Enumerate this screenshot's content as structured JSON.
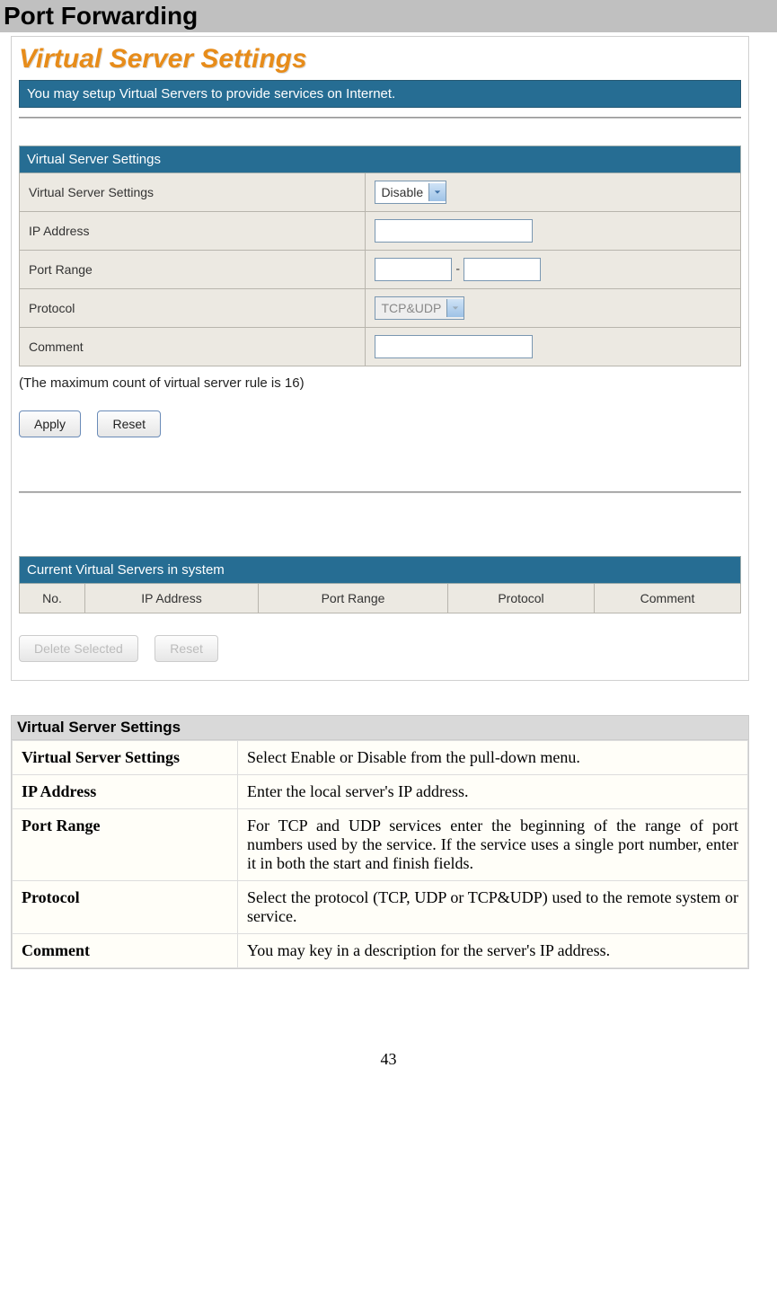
{
  "page_title": "Port Forwarding",
  "settings_heading": "Virtual Server Settings",
  "info_bar": "You may setup Virtual Servers to provide services on Internet.",
  "form": {
    "section_header": "Virtual Server Settings",
    "rows": {
      "vss_label": "Virtual Server Settings",
      "vss_value": "Disable",
      "ip_label": "IP Address",
      "ip_value": "",
      "pr_label": "Port Range",
      "pr_start": "",
      "pr_end": "",
      "pr_sep": "-",
      "proto_label": "Protocol",
      "proto_value": "TCP&UDP",
      "comment_label": "Comment",
      "comment_value": ""
    },
    "note": "(The maximum count of virtual server rule is 16)",
    "apply": "Apply",
    "reset": "Reset"
  },
  "current": {
    "header": "Current Virtual Servers in system",
    "cols": {
      "no": "No.",
      "ip": "IP Address",
      "pr": "Port Range",
      "proto": "Protocol",
      "comment": "Comment"
    },
    "delete": "Delete Selected",
    "reset": "Reset"
  },
  "help": {
    "title": "Virtual Server Settings",
    "rows": [
      {
        "label": "Virtual Server Settings",
        "desc": "Select Enable or Disable from the pull-down menu."
      },
      {
        "label": "IP Address",
        "desc": "Enter the local server's IP address."
      },
      {
        "label": "Port Range",
        "desc": "For TCP and UDP services enter the beginning of the range of port numbers used by the service. If the service uses a single port number, enter it in both the start and finish fields."
      },
      {
        "label": "Protocol",
        "desc": "Select the protocol (TCP, UDP or TCP&UDP) used to the remote system or service."
      },
      {
        "label": "Comment",
        "desc": "You may key in a description for the server's IP address."
      }
    ]
  },
  "page_number": "43"
}
